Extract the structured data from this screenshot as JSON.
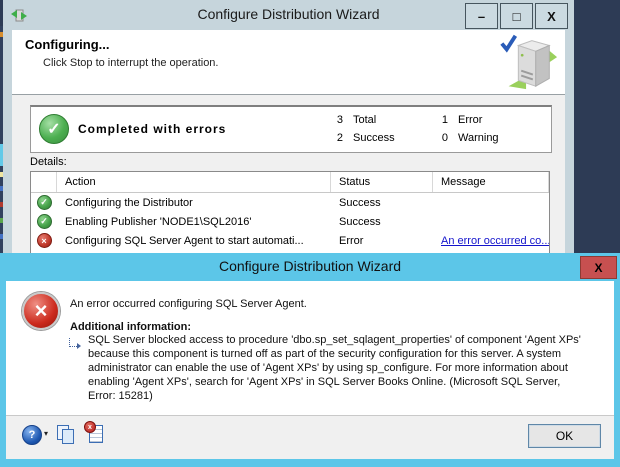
{
  "wizard_window": {
    "title": "Configure Distribution Wizard",
    "controls": {
      "minimize": "–",
      "maximize": "□",
      "close": "X"
    },
    "header": {
      "heading": "Configuring...",
      "subtitle": "Click Stop to interrupt the operation."
    },
    "summary": {
      "status_label": "Completed with errors",
      "success_check_glyph": "✓",
      "counts": [
        {
          "value": "3",
          "label": "Total"
        },
        {
          "value": "2",
          "label": "Success"
        },
        {
          "value": "1",
          "label": "Error"
        },
        {
          "value": "0",
          "label": "Warning"
        }
      ]
    },
    "details_label": "Details:",
    "table": {
      "columns": {
        "action": "Action",
        "status": "Status",
        "message": "Message"
      },
      "rows": [
        {
          "icon": "success",
          "action": "Configuring the Distributor",
          "status": "Success",
          "message": ""
        },
        {
          "icon": "success",
          "action": "Enabling Publisher 'NODE1\\SQL2016'",
          "status": "Success",
          "message": ""
        },
        {
          "icon": "error",
          "action": "Configuring SQL Server Agent to start automati...",
          "status": "Error",
          "message": "An error occurred co..."
        }
      ]
    }
  },
  "error_dialog": {
    "title": "Configure Distribution Wizard",
    "close_label": "X",
    "error_glyph": "×",
    "message": "An error occurred configuring SQL Server Agent.",
    "additional_info_label": "Additional information:",
    "detail_text": "SQL Server blocked access to procedure 'dbo.sp_set_sqlagent_properties' of component 'Agent XPs' because this component is turned off as part of the security configuration for this server. A system administrator can enable the use of 'Agent XPs' by using sp_configure. For more information about enabling 'Agent XPs', search for 'Agent XPs' in SQL Server Books Online. (Microsoft SQL Server, Error: 15281)",
    "help_glyph": "?",
    "help_caret_glyph": "▾",
    "badge_glyph": "x",
    "ok_label": "OK"
  },
  "colors": {
    "desktop_background": "#2d3b55",
    "wizard_chrome": "#c6d5dc",
    "dialog_titlebar_blue": "#5cc6e8",
    "close_button_red": "#c75050",
    "success_green": "#43a047",
    "error_red": "#c0392b",
    "link_blue": "#1414cc"
  }
}
